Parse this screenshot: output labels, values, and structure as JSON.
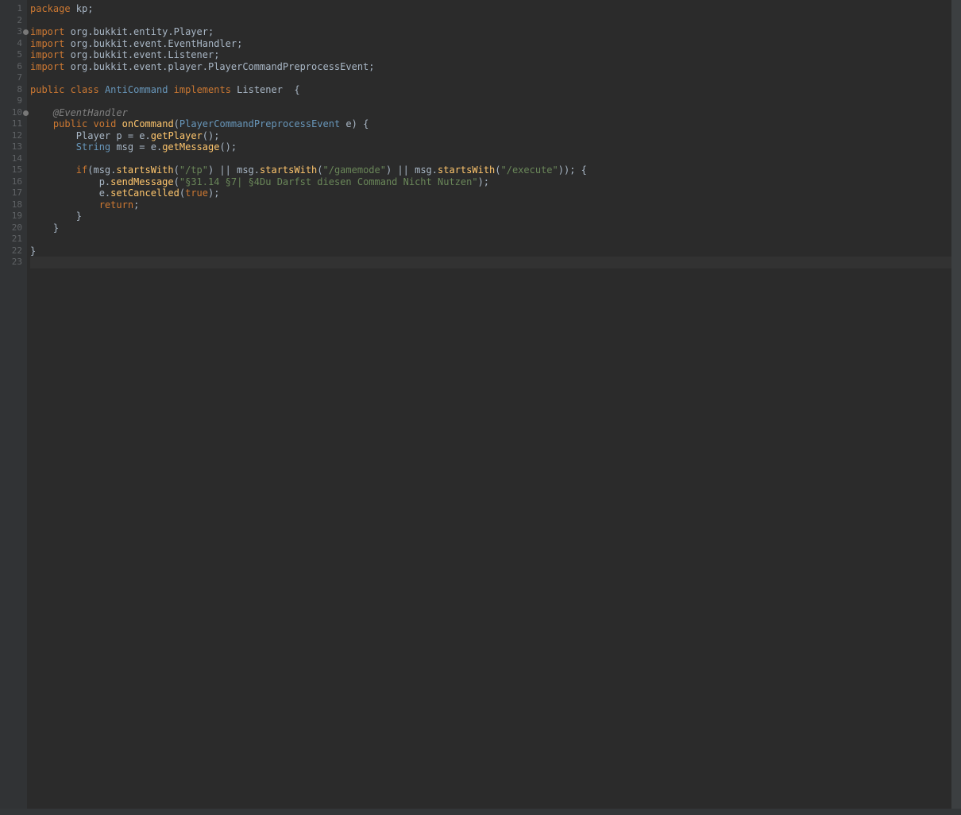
{
  "gutter": {
    "lines": [
      "1",
      "2",
      "3",
      "4",
      "5",
      "6",
      "7",
      "8",
      "9",
      "10",
      "11",
      "12",
      "13",
      "14",
      "15",
      "16",
      "17",
      "18",
      "19",
      "20",
      "21",
      "22",
      "23"
    ],
    "markers": [
      3,
      10
    ]
  },
  "code": {
    "line1": {
      "kw": "package",
      "pkg": " kp",
      "punc": ";"
    },
    "line2": {
      "blank": ""
    },
    "line3": {
      "kw": "import",
      "pkg": " org.bukkit.entity.Player",
      "punc": ";"
    },
    "line4": {
      "kw": "import",
      "pkg": " org.bukkit.event.EventHandler",
      "punc": ";"
    },
    "line5": {
      "kw": "import",
      "pkg": " org.bukkit.event.Listener",
      "punc": ";"
    },
    "line6": {
      "kw": "import",
      "pkg": " org.bukkit.event.player.PlayerCommandPreprocessEvent",
      "punc": ";"
    },
    "line7": {
      "blank": ""
    },
    "line8": {
      "kw1": "public",
      "kw2": "class",
      "cls": "AntiCommand",
      "kw3": "implements",
      "iface": "Listener",
      "brace": "{"
    },
    "line9": {
      "blank": ""
    },
    "line10": {
      "anno": "@EventHandler"
    },
    "line11": {
      "kw1": "public",
      "kw2": "void",
      "method": "onCommand",
      "paren1": "(",
      "ptype": "PlayerCommandPreprocessEvent",
      "pname": " e",
      "paren2": ")",
      "brace": " {"
    },
    "line12": {
      "type": "Player",
      "var": " p ",
      "eq": "=",
      "call": " e.",
      "method": "getPlayer",
      "rest": "();"
    },
    "line13": {
      "type": "String",
      "var": " msg ",
      "eq": "=",
      "call": " e.",
      "method": "getMessage",
      "rest": "();"
    },
    "line14": {
      "blank": ""
    },
    "line15": {
      "kw": "if",
      "p1": "(msg.",
      "m1": "startsWith",
      "p2": "(",
      "s1": "\"/tp\"",
      "p3": ") || msg.",
      "m2": "startsWith",
      "p4": "(",
      "s2": "\"/gamemode\"",
      "p5": ") || msg.",
      "m3": "startsWith",
      "p6": "(",
      "s3": "\"/execute\"",
      "p7": ")); {"
    },
    "line16": {
      "pre": "p.",
      "method": "sendMessage",
      "p1": "(",
      "str": "\"§31.14 §7| §4Du Darfst diesen Command Nicht Nutzen\"",
      "p2": ");"
    },
    "line17": {
      "pre": "e.",
      "method": "setCancelled",
      "p1": "(",
      "bool": "true",
      "p2": ");"
    },
    "line18": {
      "kw": "return",
      "punc": ";"
    },
    "line19": {
      "brace": "}"
    },
    "line20": {
      "brace": "}"
    },
    "line21": {
      "blank": ""
    },
    "line22": {
      "brace": "}"
    },
    "line23": {
      "blank": ""
    }
  }
}
